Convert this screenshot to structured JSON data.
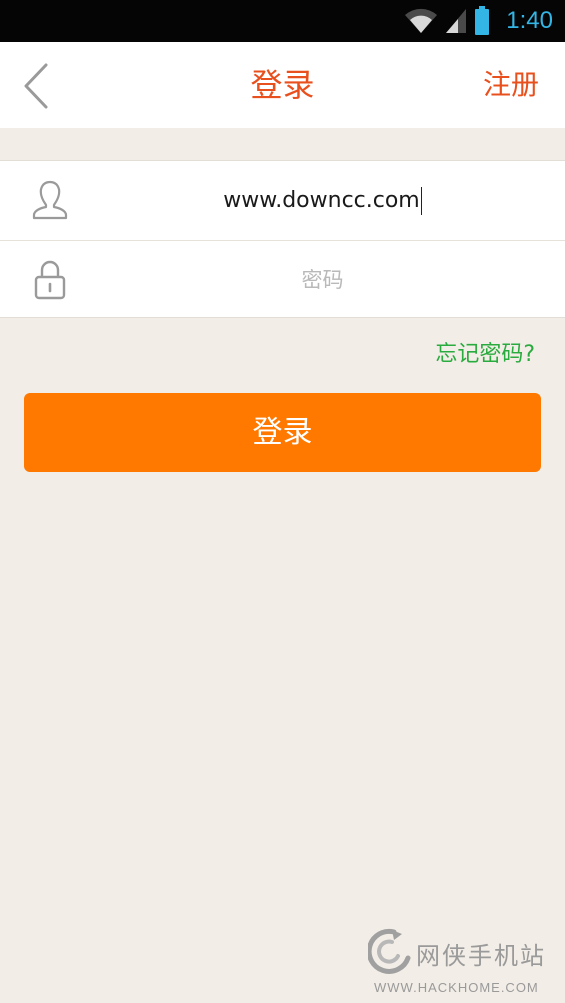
{
  "status_bar": {
    "time": "1:40",
    "icons": [
      "wifi-icon",
      "signal-icon",
      "battery-icon"
    ],
    "accent_color": "#33b5e5"
  },
  "header": {
    "back_icon": "chevron-left-icon",
    "title": "登录",
    "register_label": "注册",
    "accent_color": "#e8501e"
  },
  "form": {
    "username": {
      "icon": "user-icon",
      "value": "www.downcc.com"
    },
    "password": {
      "icon": "lock-icon",
      "placeholder": "密码"
    }
  },
  "forgot_password_label": "忘记密码?",
  "login_button": {
    "label": "登录",
    "color": "#ff7800"
  },
  "watermark": {
    "name": "网侠手机站",
    "url": "WWW.HACKHOME.COM"
  }
}
